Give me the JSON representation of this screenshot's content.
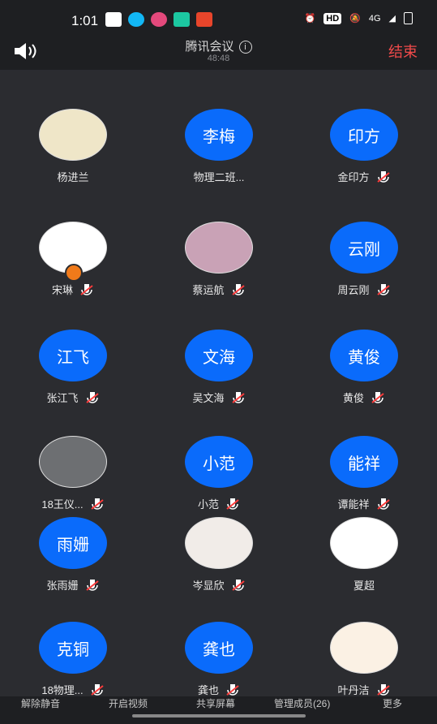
{
  "status_bar": {
    "time": "1:01",
    "right_text": "HD",
    "network": "4G"
  },
  "header": {
    "title": "腾讯会议",
    "timer": "48:48",
    "end_label": "结束"
  },
  "participants": [
    {
      "avatar_text": "",
      "name": "杨进兰",
      "muted": false,
      "photo": true
    },
    {
      "avatar_text": "李梅",
      "name": "物理二班...",
      "muted": false,
      "photo": false
    },
    {
      "avatar_text": "印方",
      "name": "金印方",
      "muted": true,
      "photo": false
    },
    {
      "avatar_text": "",
      "name": "宋琳",
      "muted": true,
      "photo": true,
      "host": true
    },
    {
      "avatar_text": "",
      "name": "蔡运航",
      "muted": true,
      "photo": true
    },
    {
      "avatar_text": "云刚",
      "name": "周云刚",
      "muted": true,
      "photo": false
    },
    {
      "avatar_text": "江飞",
      "name": "张江飞",
      "muted": true,
      "photo": false
    },
    {
      "avatar_text": "文海",
      "name": "吴文海",
      "muted": true,
      "photo": false
    },
    {
      "avatar_text": "黄俊",
      "name": "黄俊",
      "muted": true,
      "photo": false
    },
    {
      "avatar_text": "",
      "name": "18王仪...",
      "muted": true,
      "photo": true
    },
    {
      "avatar_text": "小范",
      "name": "小范",
      "muted": true,
      "photo": false
    },
    {
      "avatar_text": "能祥",
      "name": "谭能祥",
      "muted": true,
      "photo": false
    },
    {
      "avatar_text": "雨姗",
      "name": "张雨姗",
      "muted": true,
      "photo": false
    },
    {
      "avatar_text": "",
      "name": "岑显欣",
      "muted": true,
      "photo": true
    },
    {
      "avatar_text": "",
      "name": "夏超",
      "muted": false,
      "photo": true
    },
    {
      "avatar_text": "克铜",
      "name": "18物理...",
      "muted": true,
      "photo": false
    },
    {
      "avatar_text": "龚也",
      "name": "龚也",
      "muted": true,
      "photo": false
    },
    {
      "avatar_text": "",
      "name": "叶丹洁",
      "muted": true,
      "photo": true
    }
  ],
  "toolbar": {
    "unmute": "解除静音",
    "video": "开启视频",
    "share": "共享屏幕",
    "manage": "管理成员(26)",
    "more": "更多"
  },
  "colors": {
    "avatar_blue": "#0a6bfb",
    "end_red": "#f04a4a",
    "background": "#2b2c30"
  }
}
